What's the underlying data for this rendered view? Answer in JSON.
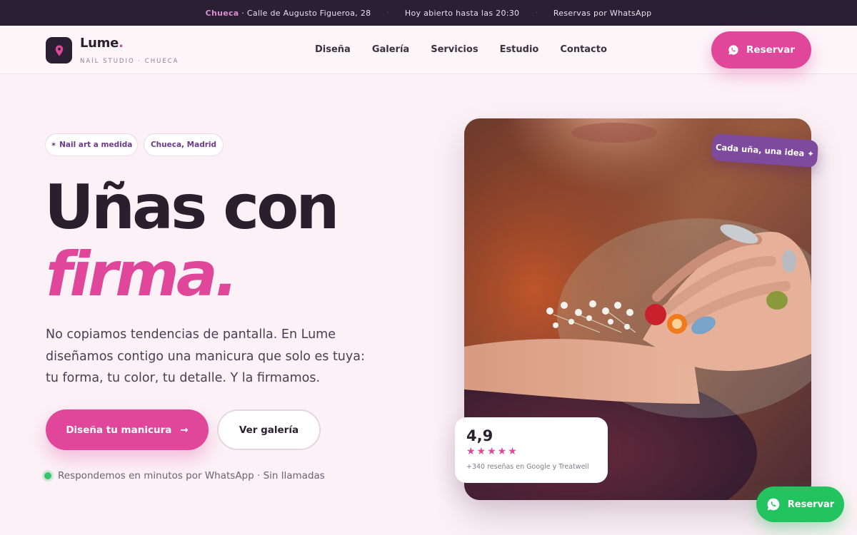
{
  "topbar": {
    "location_highlight": "Chueca",
    "address": "· Calle de Augusto Figueroa, 28",
    "hours": "Hoy abierto hasta las 20:30",
    "whatsapp": "Reservas por WhatsApp",
    "separator": "·"
  },
  "header": {
    "brand_name": "Lume",
    "brand_dot": ".",
    "tagline": "NAIL STUDIO · CHUECA",
    "nav": [
      "Diseña",
      "Galería",
      "Servicios",
      "Estudio",
      "Contacto"
    ],
    "cta_label": "Reservar",
    "cta_icon": "whatsapp-icon"
  },
  "hero": {
    "pills": [
      "✶ Nail art a medida",
      "Chueca, Madrid"
    ],
    "headline_line1": "Uñas con",
    "headline_line2": "firma.",
    "lead": "No copiamos tendencias de pantalla. En Lume diseñamos contigo una manicura que solo es tuya: tu forma, tu color, tu detalle. Y la firmamos.",
    "primary_button": "Diseña tu manicura",
    "primary_button_icon": "→",
    "secondary_button": "Ver galería",
    "note": "Respondemos en minutos por WhatsApp · Sin llamadas",
    "photo_tag": "Cada uña, una idea ✦",
    "rating": {
      "value": "4,9",
      "stars": "★★★★★",
      "stars_count": 5,
      "reviews": "+340 reseñas en Google y Treatwell"
    }
  },
  "floating_whatsapp": {
    "label": "Reservar",
    "icon": "whatsapp-icon"
  },
  "colors": {
    "accent": "#e0479b",
    "dark": "#2a1f2d",
    "purple": "#7e4a9e",
    "whatsapp": "#23c45f",
    "background": "#fcf1f6"
  }
}
